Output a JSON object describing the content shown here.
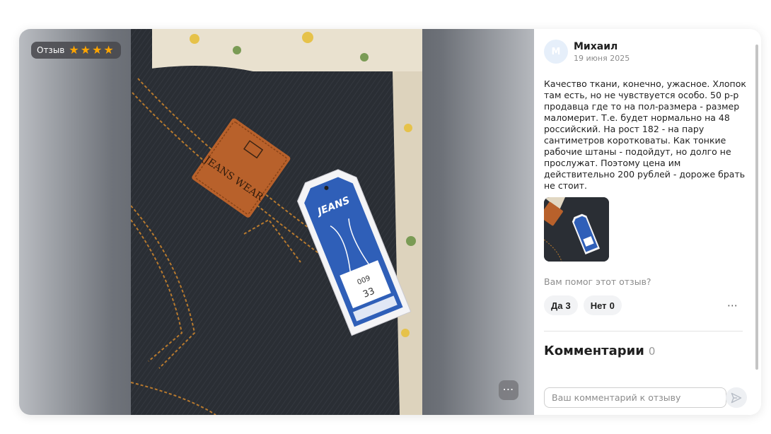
{
  "media": {
    "badge_label": "Отзыв",
    "rating": 4,
    "rating_max": 4,
    "more_icon": "⋯"
  },
  "review": {
    "author_initial": "М",
    "author_name": "Михаил",
    "date": "19 июня 2025",
    "text": "Качество ткани, конечно, ужасное. Хлопок там есть, но не чувствуется особо. 50 р-р продавца где то на пол-размера - размер маломерит. Т.е. будет нормально на 48 российский. На рост 182 - на пару сантиметров коротковаты. Как тонкие рабочие штаны - подойдут, но долго не прослужат. Поэтому цена им действительно 200 рублей - дороже брать не стоит."
  },
  "photo_labels": {
    "leather_patch": "JEANS WEAR",
    "tag_brand": "JEANS",
    "tag_size": "33",
    "tag_code": "009"
  },
  "helpful": {
    "question": "Вам помог этот отзыв?",
    "yes_label": "Да",
    "yes_count": "3",
    "no_label": "Нет",
    "no_count": "0",
    "more_icon": "⋯"
  },
  "comments": {
    "title": "Комментарии",
    "count": "0",
    "input_placeholder": "Ваш комментарий к отзыву"
  },
  "colors": {
    "accent_star": "#ffa500",
    "tag_blue": "#2f5fb8",
    "leather": "#b8612b"
  }
}
